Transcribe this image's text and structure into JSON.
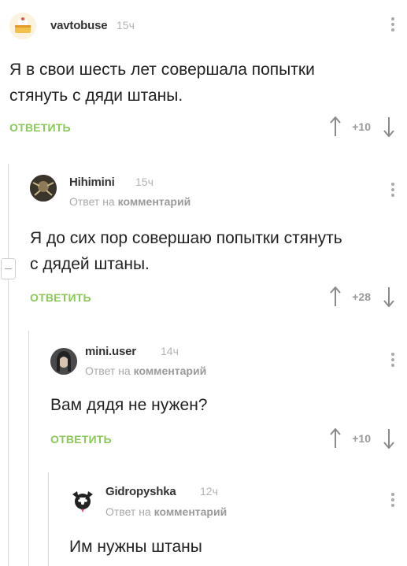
{
  "comments": [
    {
      "username": "vavtobuse",
      "time": "15ч",
      "reply_to_prefix": "",
      "reply_to_target": "",
      "lines": [
        "Я в свои шесть лет совершала попытки",
        "стянуть с дяди штаны."
      ],
      "reply_label": "ОТВЕТИТЬ",
      "score": "+10"
    },
    {
      "username": "Hihimini",
      "time": "15ч",
      "reply_to_prefix": "Ответ на",
      "reply_to_target": "комментарий",
      "lines": [
        "Я до сих пор совершаю попытки стянуть",
        "с дядей штаны."
      ],
      "reply_label": "ОТВЕТИТЬ",
      "score": "+28"
    },
    {
      "username": "mini.user",
      "time": "14ч",
      "reply_to_prefix": "Ответ на",
      "reply_to_target": "комментарий",
      "lines": [
        "Вам дядя не нужен?"
      ],
      "reply_label": "ОТВЕТИТЬ",
      "score": "+10"
    },
    {
      "username": "Gidropyshka",
      "time": "12ч",
      "reply_to_prefix": "Ответ на",
      "reply_to_target": "комментарий",
      "lines": [
        "Им нужны штаны"
      ],
      "reply_label": "",
      "score": ""
    }
  ],
  "colors": {
    "reply_green": "#8ac858",
    "muted_gray": "#a9a9a9",
    "thread_line": "#d9d9d9"
  },
  "icons": [
    "cake-avatar-icon",
    "kebab-menu-icon",
    "upvote-arrow-icon",
    "downvote-arrow-icon",
    "collapse-thread-icon",
    "dog-avatar-icon"
  ]
}
